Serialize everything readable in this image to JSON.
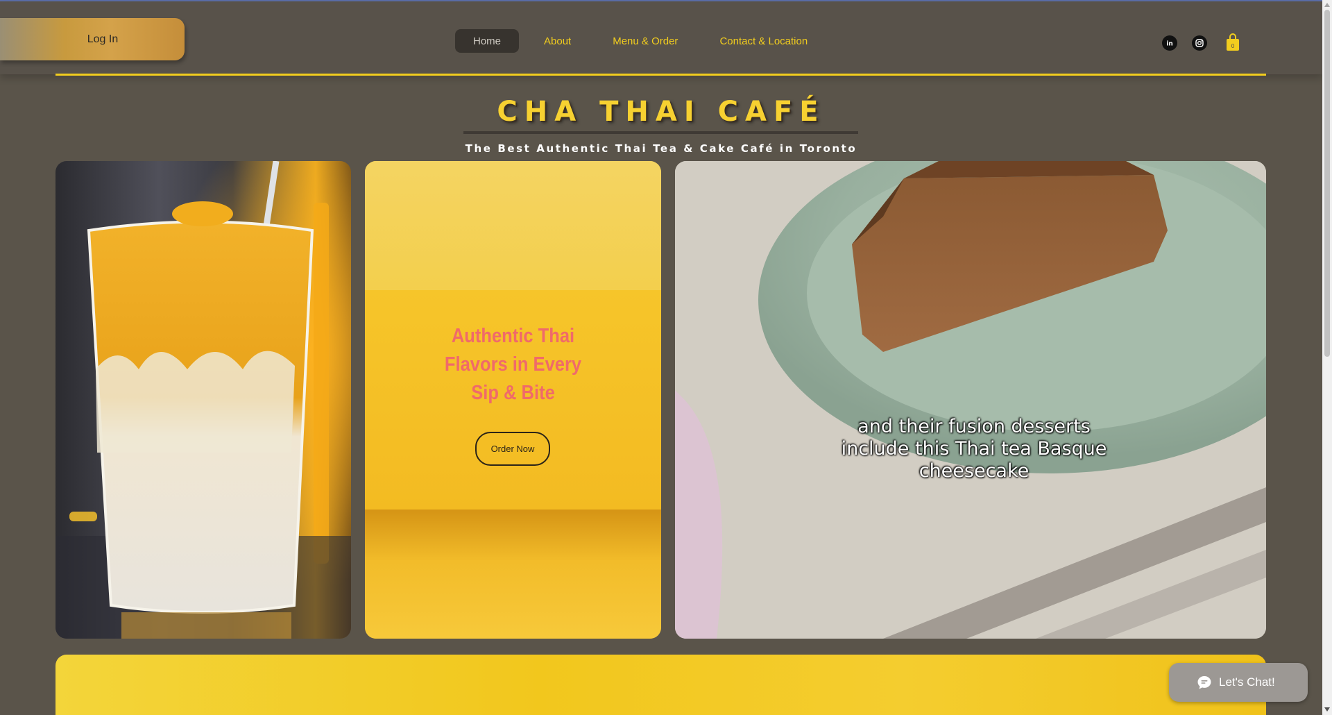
{
  "header": {
    "login_label": "Log In",
    "nav": [
      {
        "label": "Home",
        "active": true
      },
      {
        "label": "About",
        "active": false
      },
      {
        "label": "Menu & Order",
        "active": false
      },
      {
        "label": "Contact & Location",
        "active": false
      }
    ],
    "social": [
      "linkedin-icon",
      "instagram-icon"
    ],
    "cart_count": "0"
  },
  "hero": {
    "title": "CHA THAI CAFÉ",
    "subtitle": "The Best Authentic Thai Tea & Cake Café in Toronto"
  },
  "promo": {
    "line1": "Authentic Thai",
    "line2": "Flavors in Every",
    "line3": "Sip & Bite",
    "button": "Order Now"
  },
  "cake": {
    "line1": "and their fusion desserts",
    "line2": "include this Thai tea Basque",
    "line3": "cheesecake"
  },
  "chat": {
    "label": "Let's Chat!"
  },
  "colors": {
    "accent_yellow": "#f2cd1e",
    "background": "#5a544a",
    "promo_text": "#f06a6a"
  }
}
